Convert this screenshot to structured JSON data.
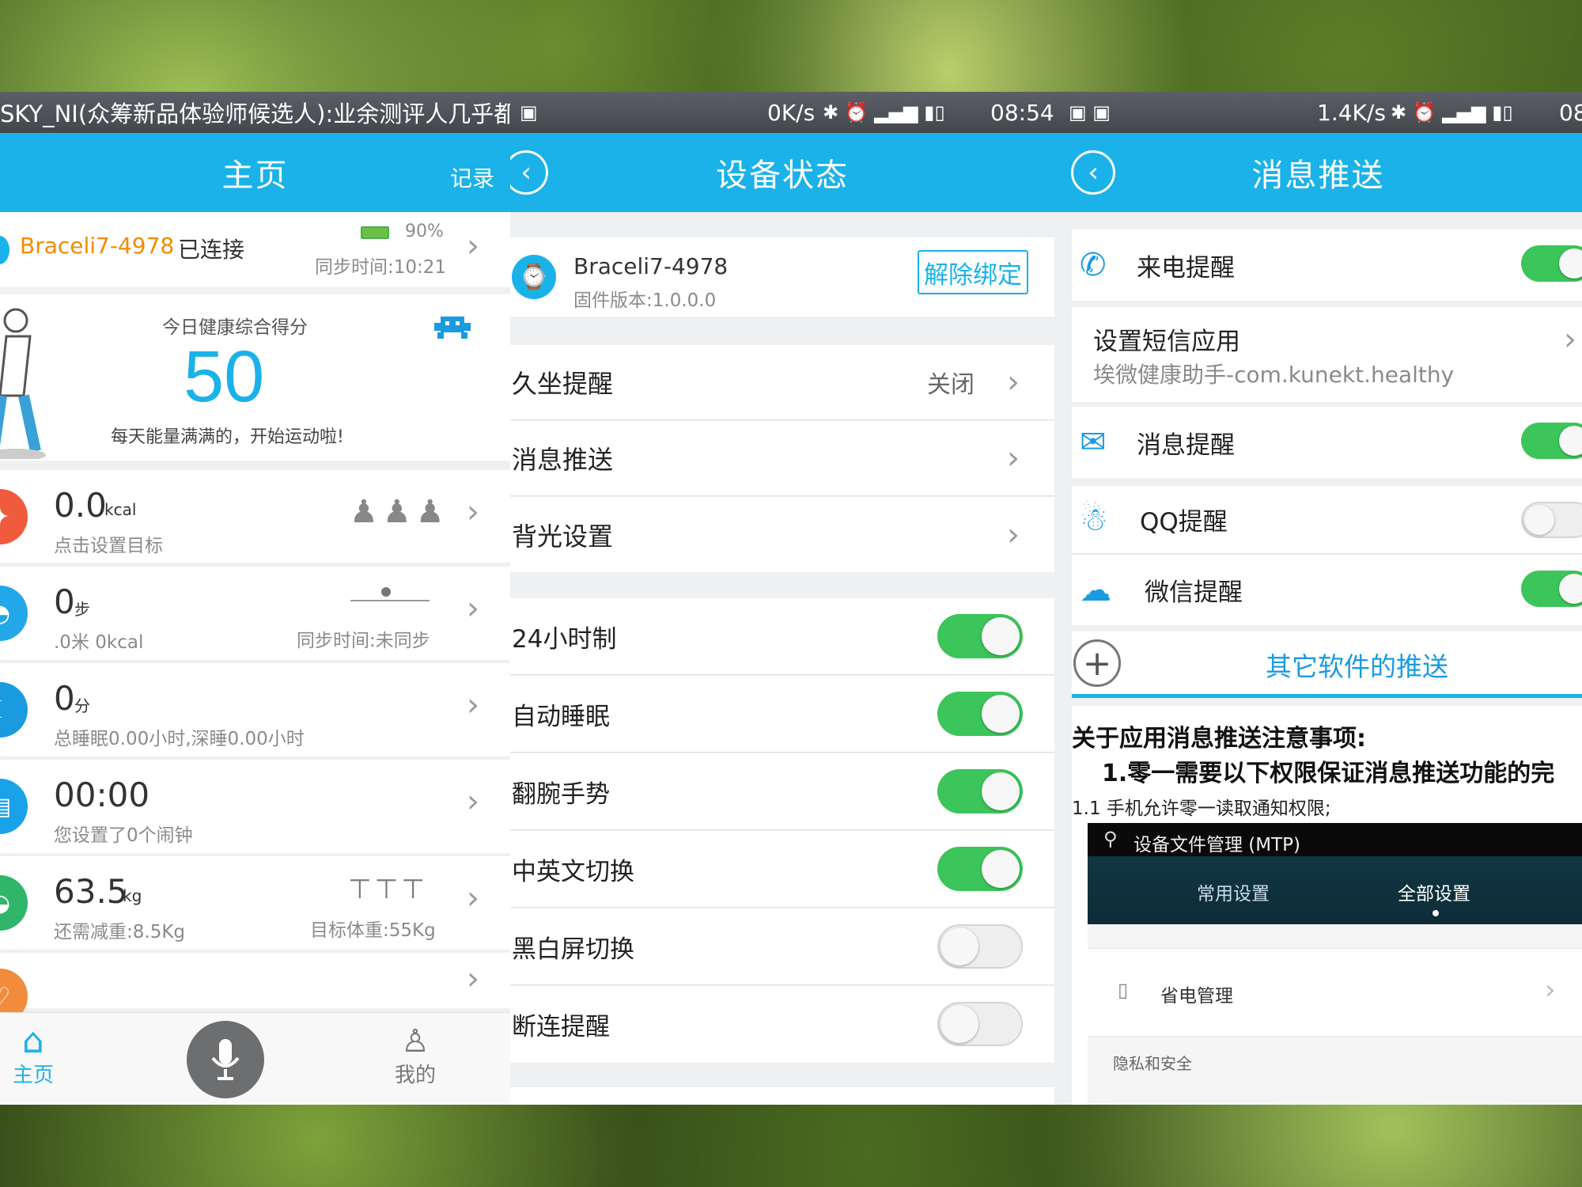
{
  "panel1": {
    "notification": "SKY_NI(众筹新品体验师候选人):业余测评人几乎都",
    "title": "主页",
    "record_label": "记录",
    "device": {
      "name": "Braceli7-4978",
      "status": "已连接",
      "battery": "90%",
      "sync": "同步时间:10:21"
    },
    "score": {
      "label": "今日健康综合得分",
      "value": "50",
      "message": "每天能量满满的，开始运动啦!"
    },
    "items": [
      {
        "main": "0.0",
        "unit": "kcal",
        "sub": "点击设置目标",
        "right": "",
        "color": "#ef5b3c"
      },
      {
        "main": "0",
        "unit": "步",
        "sub": ".0米    0kcal",
        "right": "同步时间:未同步",
        "color": "#23a7e8"
      },
      {
        "main": "0",
        "unit": "分",
        "sub": "总睡眠0.00小时,深睡0.00小时",
        "right": "",
        "color": "#1a9be0"
      },
      {
        "main": "00:00",
        "unit": "",
        "sub": "您设置了0个闹钟",
        "right": "",
        "color": "#1aa2e8"
      },
      {
        "main": "63.5",
        "unit": "kg",
        "sub": "还需减重:8.5Kg",
        "right": "目标体重:55Kg",
        "color": "#2fb66a"
      }
    ],
    "nav": {
      "home": "主页",
      "mine": "我的"
    }
  },
  "panel2": {
    "status": {
      "speed": "0K/s",
      "time": "08:54"
    },
    "title": "设备状态",
    "device": {
      "name": "Braceli7-4978",
      "firmware": "固件版本:1.0.0.0",
      "unbind": "解除绑定"
    },
    "menu": [
      {
        "label": "久坐提醒",
        "value": "关闭"
      },
      {
        "label": "消息推送",
        "value": ""
      },
      {
        "label": "背光设置",
        "value": ""
      }
    ],
    "toggles": [
      {
        "label": "24小时制",
        "on": true
      },
      {
        "label": "自动睡眠",
        "on": true
      },
      {
        "label": "翻腕手势",
        "on": true
      },
      {
        "label": "中英文切换",
        "on": true
      },
      {
        "label": "黑白屏切换",
        "on": false
      },
      {
        "label": "断连提醒",
        "on": false
      }
    ]
  },
  "panel3": {
    "status": {
      "speed": "1.4K/s",
      "time": "08"
    },
    "title": "消息推送",
    "call": {
      "label": "来电提醒",
      "on": true
    },
    "sms": {
      "label": "设置短信应用",
      "app": "埃微健康助手-com.kunekt.healthy"
    },
    "msg": {
      "label": "消息提醒",
      "on": true
    },
    "qq": {
      "label": "QQ提醒",
      "on": false
    },
    "wechat": {
      "label": "微信提醒",
      "on": true
    },
    "other": "其它软件的推送",
    "notes": {
      "heading": "关于应用消息推送注意事项:",
      "point1": "1.零一需要以下权限保证消息推送功能的完",
      "point1_1": "1.1 手机允许零一读取通知权限;"
    },
    "screenshot": {
      "usb": "设备文件管理 (MTP)",
      "tab1": "常用设置",
      "tab2": "全部设置",
      "item": "省电管理",
      "section": "隐私和安全"
    }
  }
}
